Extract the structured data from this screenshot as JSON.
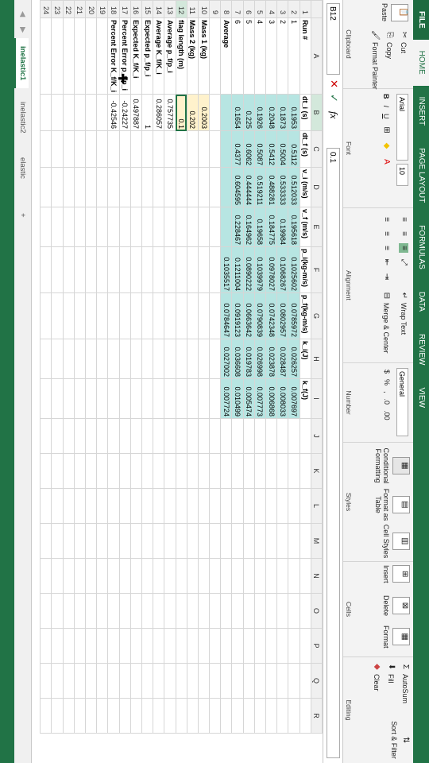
{
  "ribbon": {
    "tabs": [
      "FILE",
      "HOME",
      "INSERT",
      "PAGE LAYOUT",
      "FORMULAS",
      "DATA",
      "REVIEW",
      "VIEW"
    ],
    "clipboard": {
      "cut": "Cut",
      "copy": "Copy",
      "format_painter": "Format Painter",
      "paste": "Paste",
      "caption": "Clipboard"
    },
    "font": {
      "name": "Arial",
      "size": "10",
      "caption": "Font"
    },
    "alignment": {
      "wrap": "Wrap Text",
      "merge": "Merge & Center",
      "caption": "Alignment"
    },
    "number": {
      "format": "General",
      "caption": "Number"
    },
    "styles": {
      "conditional": "Conditional Formatting",
      "format_as_table": "Format as Table",
      "cell_styles": "Cell Styles",
      "caption": "Styles"
    },
    "cells": {
      "insert": "Insert",
      "delete": "Delete",
      "format": "Format",
      "caption": "Cells"
    },
    "editing": {
      "autosum": "AutoSum",
      "fill": "Fill",
      "clear": "Clear",
      "sort": "Sort & Filter",
      "caption": "Editing"
    }
  },
  "formula_bar": {
    "name_box": "B12",
    "value": "0.1"
  },
  "columns": [
    "A",
    "B",
    "C",
    "D",
    "E",
    "F",
    "G",
    "H",
    "I",
    "J",
    "K",
    "L",
    "M",
    "N",
    "O",
    "P",
    "Q",
    "R"
  ],
  "rows": [
    [
      "Run #",
      "dt_i (s)",
      "dt_f (s)",
      "v_i (m/s)",
      "v_f (m/s)",
      "p_i(kg-m/s)",
      "p_f(kg-m/s)",
      "k_i(J)",
      "k_f(J)"
    ],
    [
      "1",
      "0.1953",
      "0.5112",
      "0.512033",
      "0.195618",
      "0.1025602",
      "0.0785972",
      "0.026257",
      "0.007697"
    ],
    [
      "2",
      "0.1873",
      "0.5004",
      "0.533333",
      "0.19984",
      "0.1068267",
      "0.0802957",
      "0.028487",
      "0.008033"
    ],
    [
      "3",
      "0.2048",
      "0.5412",
      "0.488281",
      "0.184775",
      "0.0978027",
      "0.0742348",
      "0.023878",
      "0.006868"
    ],
    [
      "4",
      "0.1926",
      "0.5087",
      "0.519211",
      "0.19658",
      "0.1039979",
      "0.0790839",
      "0.026998",
      "0.007773"
    ],
    [
      "5",
      "0.225",
      "0.6062",
      "0.444444",
      "0.164962",
      "0.0890222",
      "0.0663642",
      "0.019783",
      "0.005474"
    ],
    [
      "6",
      "0.1654",
      "0.4377",
      "0.604595",
      "0.228467",
      "0.1211004",
      "0.0919123",
      "0.036608",
      "0.010499"
    ],
    [
      "Average",
      "",
      "",
      "",
      "",
      "0.1035517",
      "0.0784647",
      "0.027002",
      "0.007724"
    ],
    [
      "",
      "",
      "",
      "",
      "",
      "",
      "",
      "",
      ""
    ],
    [
      "Mass 1 (kg)",
      "0.2003",
      "",
      "",
      "",
      "",
      "",
      "",
      ""
    ],
    [
      "Mass 2 (kg)",
      "0.202",
      "",
      "",
      "",
      "",
      "",
      "",
      ""
    ],
    [
      "flag length (m)",
      "0.1",
      "",
      "",
      "",
      "",
      "",
      "",
      ""
    ],
    [
      "Average p_f/p_i",
      "0.757735",
      "",
      "",
      "",
      "",
      "",
      "",
      ""
    ],
    [
      "Average K_f/K_i",
      "0.286057",
      "",
      "",
      "",
      "",
      "",
      "",
      ""
    ],
    [
      "Expected p_f/p_i",
      "1",
      "",
      "",
      "",
      "",
      "",
      "",
      ""
    ],
    [
      "Expected K_f/K_i",
      "0.497887",
      "",
      "",
      "",
      "",
      "",
      "",
      ""
    ],
    [
      "Percent Error p_f/p_i",
      "-0.24227",
      "",
      "",
      "",
      "",
      "",
      "",
      ""
    ],
    [
      "Percent Error K_f/K_i",
      "-0.42546",
      "",
      "",
      "",
      "",
      "",
      "",
      ""
    ]
  ],
  "sheets": [
    "inelastic1",
    "inelastic2",
    "elastic"
  ],
  "add_sheet": "+"
}
